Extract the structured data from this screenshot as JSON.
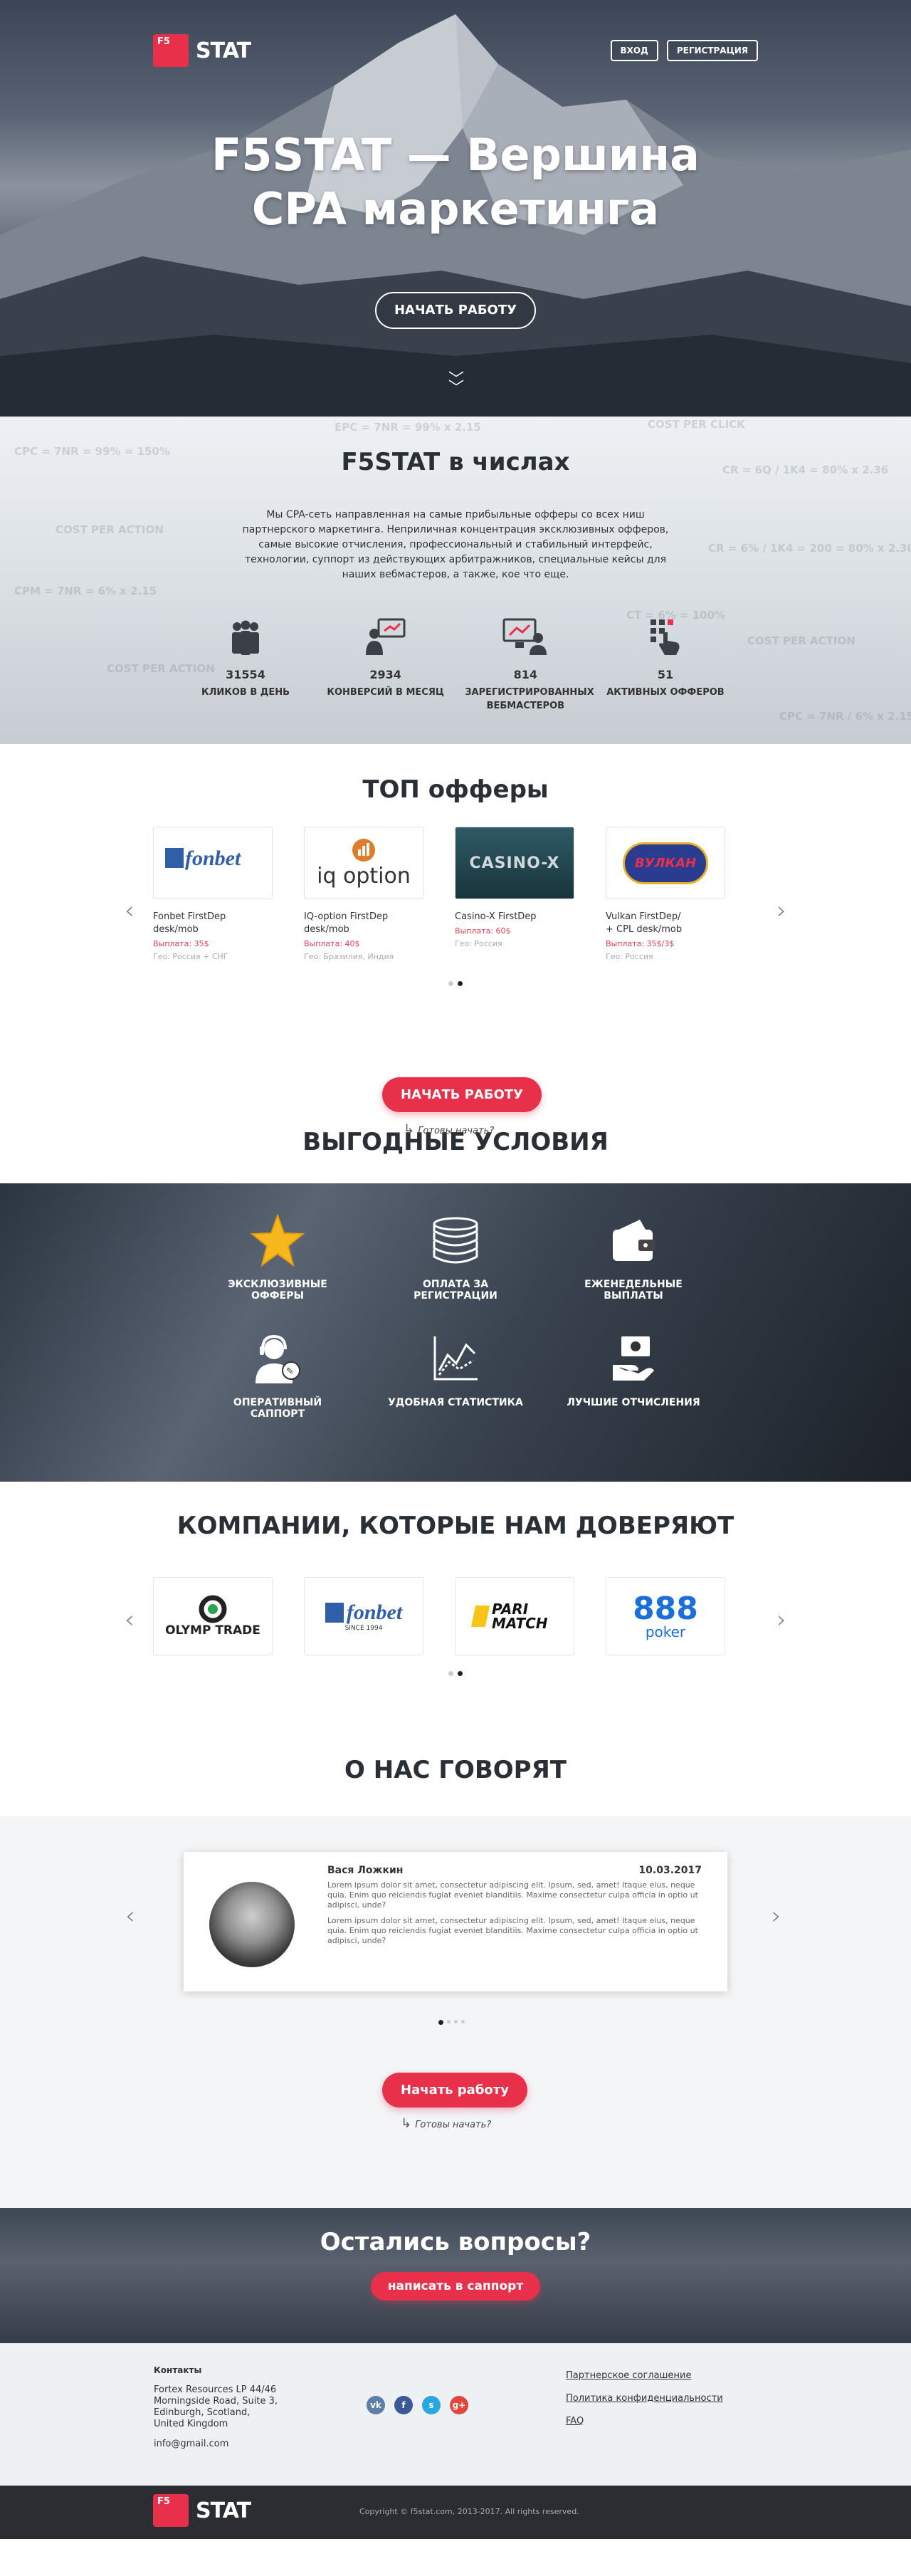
{
  "header": {
    "logo_mark": "F5",
    "logo_text": "STAT",
    "login_label": "ВХОД",
    "register_label": "РЕГИСТРАЦИЯ"
  },
  "hero": {
    "title_line1": "F5STAT — Вершина",
    "title_line2": "CPA маркетинга",
    "start_label": "НАЧАТЬ РАБОТУ"
  },
  "numbers": {
    "title": "F5STAT в числах",
    "description": "Мы CPA-сеть направленная на самые прибыльные офферы со всех ниш партнерского маркетинга. Неприличная концентрация эксклюзивных офферов, самые высокие отчисления, профессиональный и стабильный интерфейс, технологии, суппорт из действующих арбитражников, специальные кейсы для наших вебмастеров, а также, кое что еще.",
    "stats": [
      {
        "value": "31554",
        "label": "КЛИКОВ В ДЕНЬ",
        "icon": "people-icon"
      },
      {
        "value": "2934",
        "label": "КОНВЕРСИЙ В МЕСЯЦ",
        "icon": "presenter-icon"
      },
      {
        "value": "814",
        "label": "ЗАРЕГИСТРИРОВАННЫХ ВЕБМАСТЕРОВ",
        "icon": "webmaster-icon"
      },
      {
        "value": "51",
        "label": "АКТИВНЫХ ОФФЕРОВ",
        "icon": "touch-icon"
      }
    ],
    "watermarks": [
      "EPC = 7NR = 99% x 2.15",
      "COST PER CLICK",
      "CR = 6Q / 1K4 = 80% x 2.36",
      "CPC = 7NR = 99% = 150%",
      "COST PER ACTION",
      "CPM = 7NR = 6% x 2.15",
      "COST PER ACTION",
      "CR = 6% / 1K4 = 200 = 80% x 2.30",
      "CT = 6% = 100%",
      "COST PER ACTION",
      "CPC = 7NR / 6% x 2.15"
    ]
  },
  "offers": {
    "title": "ТОП офферы",
    "items": [
      {
        "logo": "fonbet",
        "name": "Fonbet FirstDep desk/mob",
        "pay": "Выплата: 35$",
        "geo": "Гео: Россия + СНГ"
      },
      {
        "logo": "iq option",
        "name": "IQ-option FirstDep desk/mob",
        "pay": "Выплата: 40$",
        "geo": "Гео: Бразилия, Индия"
      },
      {
        "logo": "CASINO-X",
        "name": "Casino-X FirstDep",
        "pay": "Выплата: 60$",
        "geo": "Гео: Россия"
      },
      {
        "logo": "ВУЛКАН",
        "name": "Vulkan FirstDep/\n+ CPL desk/mob",
        "pay": "Выплата: 35$/3$",
        "geo": "Гео: Россия"
      }
    ],
    "cta_label": "НАЧАТЬ РАБОТУ",
    "cta_hint": "Готовы начать?"
  },
  "advantages": {
    "title": "ВЫГОДНЫЕ УСЛОВИЯ",
    "items": [
      {
        "label": "ЭКСКЛЮЗИВНЫЕ ОФФЕРЫ",
        "icon": "star-icon"
      },
      {
        "label": "ОПЛАТА ЗА РЕГИСТРАЦИИ",
        "icon": "coins-icon"
      },
      {
        "label": "ЕЖЕНЕДЕЛЬНЫЕ ВЫПЛАТЫ",
        "icon": "wallet-icon"
      },
      {
        "label": "ОПЕРАТИВНЫЙ САППОРТ",
        "icon": "support-icon"
      },
      {
        "label": "УДОБНАЯ СТАТИСТИКА",
        "icon": "chart-icon"
      },
      {
        "label": "ЛУЧШИЕ ОТЧИСЛЕНИЯ",
        "icon": "money-hand-icon"
      }
    ]
  },
  "companies": {
    "title": "КОМПАНИИ, КОТОРЫЕ НАМ ДОВЕРЯЮТ",
    "items": [
      {
        "name": "OLYMP TRADE"
      },
      {
        "name": "fonbet",
        "sub": "SINCE 1994"
      },
      {
        "name": "PARI MATCH"
      },
      {
        "name": "888",
        "sub": "poker"
      }
    ]
  },
  "reviews": {
    "title": "О НАС ГОВОРЯТ",
    "author": "Вася Ложкин",
    "date": "10.03.2017",
    "text1": "Lorem ipsum dolor sit amet, consectetur adipiscing elit. Ipsum, sed, amet! Itaque eius, neque quia. Enim quo reiciendis fugiat eveniet blanditiis. Maxime consectetur culpa officia in optio ut adipisci, unde?",
    "text2": "Lorem ipsum dolor sit amet, consectetur adipiscing elit. Ipsum, sed, amet! Itaque eius, neque quia. Enim quo reiciendis fugiat eveniet blanditiis. Maxime consectetur culpa officia in optio ut adipisci, unde?",
    "cta_label": "Начать работу",
    "cta_hint": "Готовы начать?"
  },
  "questions": {
    "title": "Остались вопросы?",
    "button_label": "написать в саппорт"
  },
  "footer": {
    "contacts_title": "Контакты",
    "address": "Fortex Resources LP 44/46 Morningside Road, Suite 3, Edinburgh, Scotland, United Kingdom",
    "email": "info@gmail.com",
    "social": [
      "vk",
      "f",
      "s",
      "g+"
    ],
    "links": [
      "Партнерское соглашение",
      "Политика конфиденциальности",
      "FAQ"
    ],
    "copyright": "Copyright © f5stat.com, 2013-2017. All rights reserved."
  },
  "colors": {
    "accent": "#e8304a",
    "dark": "#2b2d33",
    "light_bg": "#eef1f4"
  }
}
